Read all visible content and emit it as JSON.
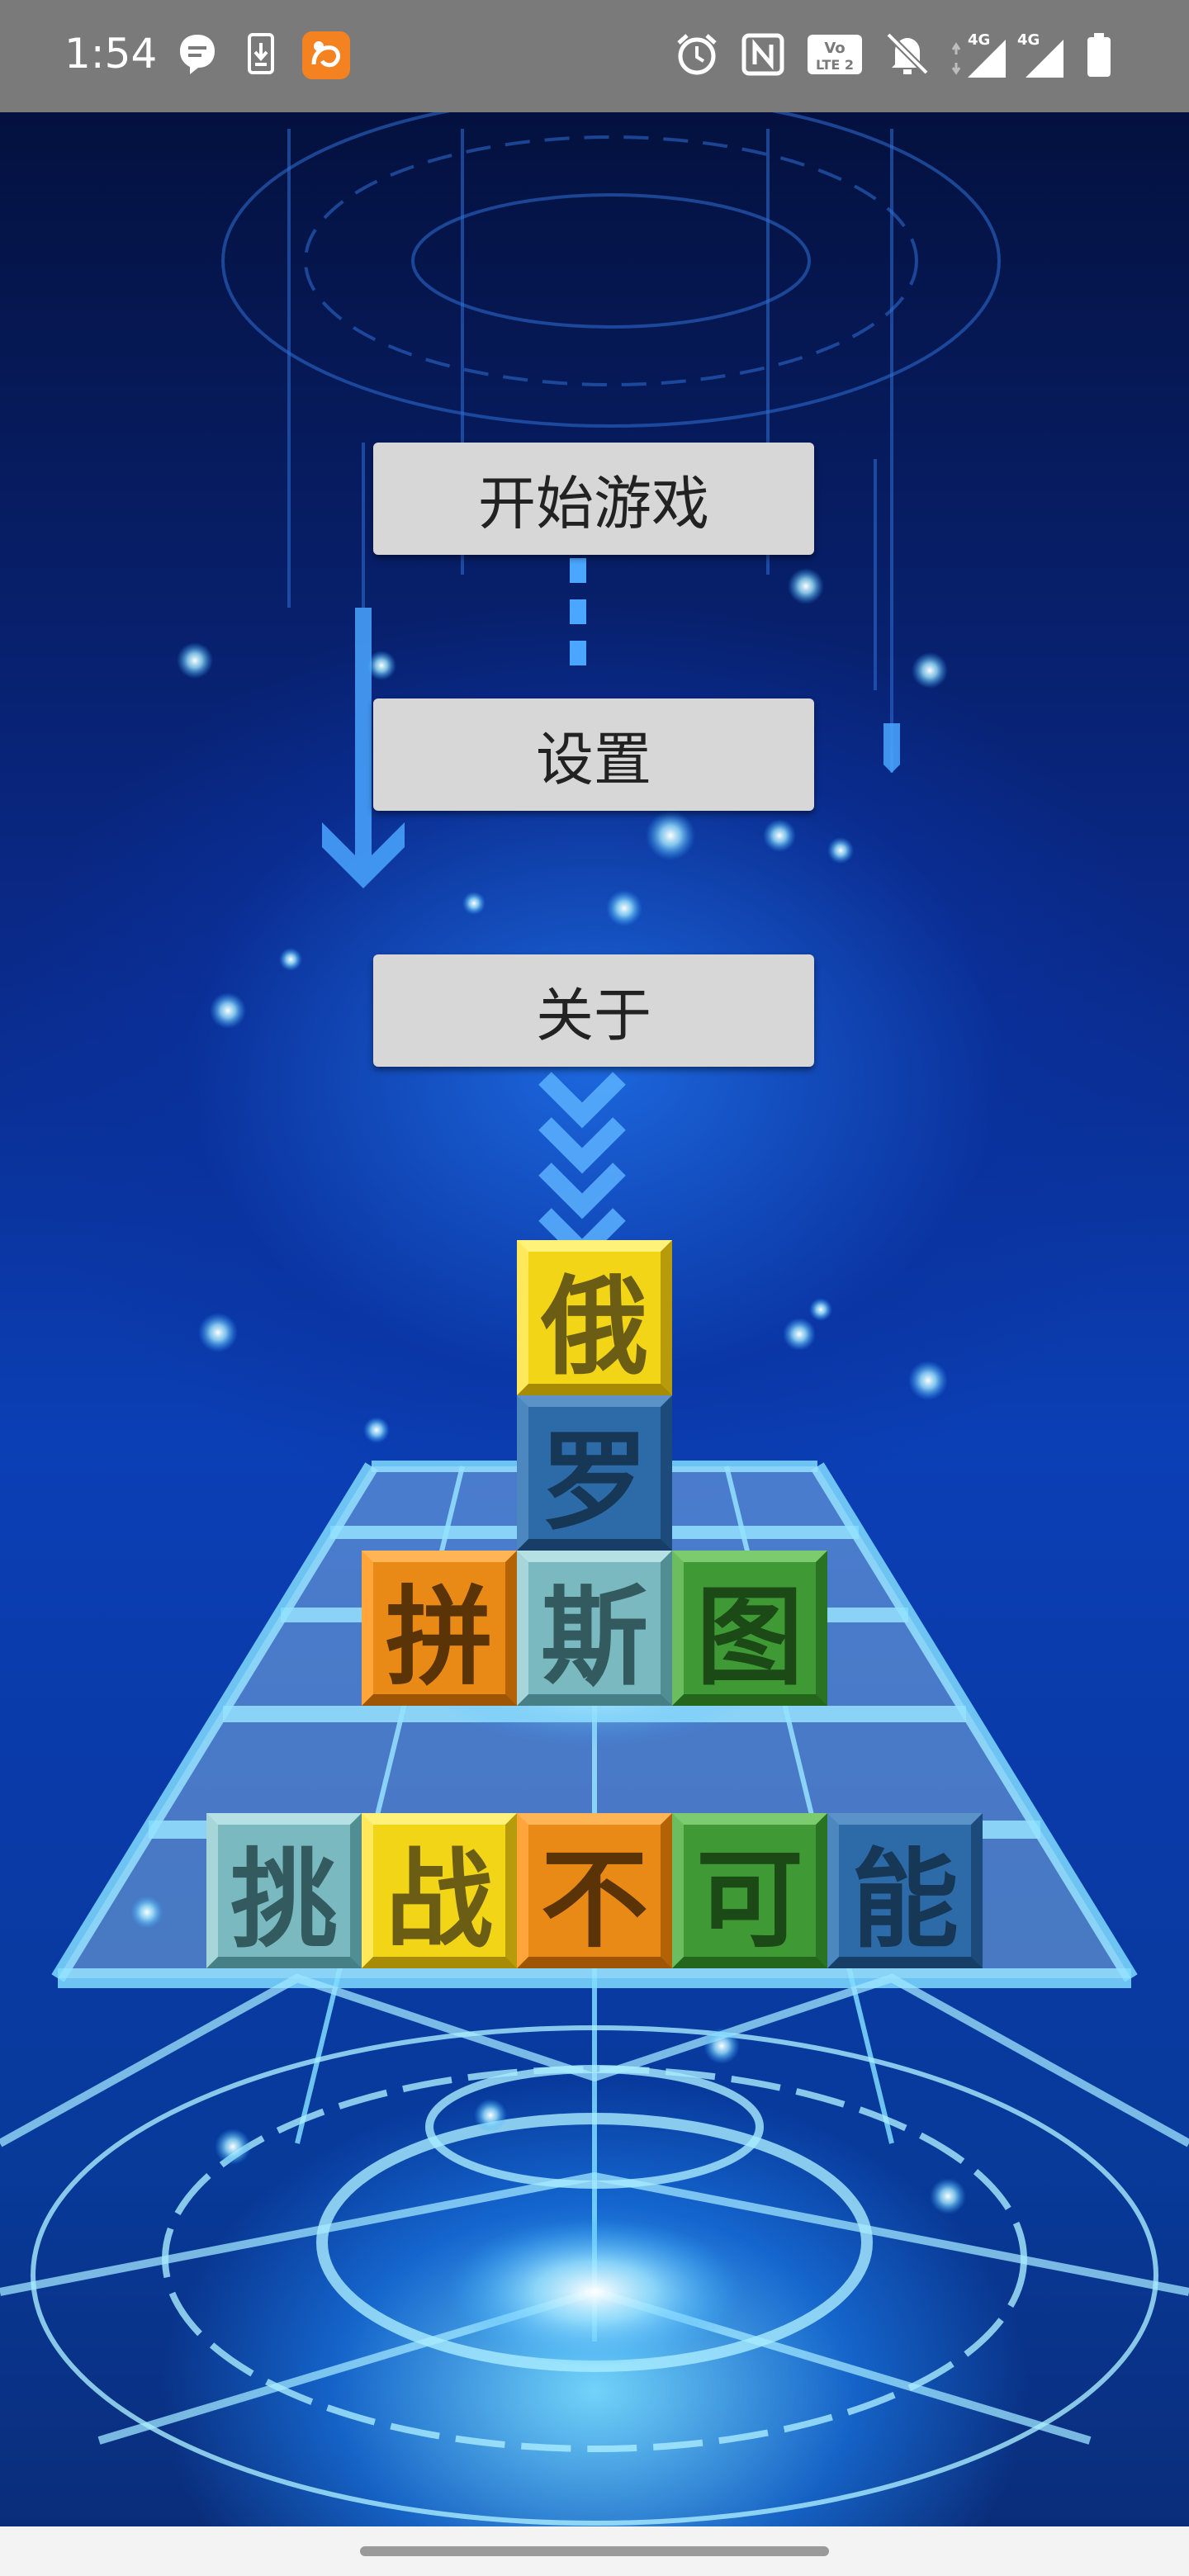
{
  "status_bar": {
    "time": "1:54",
    "icons_left": [
      "message-icon",
      "download-icon",
      "uc-browser-icon"
    ],
    "icons_right": [
      "alarm-icon",
      "nfc-icon",
      "volte-icon",
      "mute-bell-icon",
      "signal-4g-icon",
      "signal-4g-icon",
      "battery-icon"
    ],
    "volte_label": "Vo LTE 2",
    "network_label": "4G"
  },
  "menu": {
    "start_label": "开始游戏",
    "settings_label": "设置",
    "about_label": "关于"
  },
  "title_tiles": {
    "row1": [
      "俄"
    ],
    "row2": [
      "罗"
    ],
    "row3": [
      "拼",
      "斯",
      "图"
    ],
    "row4": [
      "挑",
      "战",
      "不",
      "可",
      "能"
    ]
  },
  "colors": {
    "yellow": "#f3d517",
    "blue": "#2d6aa8",
    "orange": "#ea8a16",
    "teal": "#79b9bf",
    "green": "#3f9a35"
  }
}
